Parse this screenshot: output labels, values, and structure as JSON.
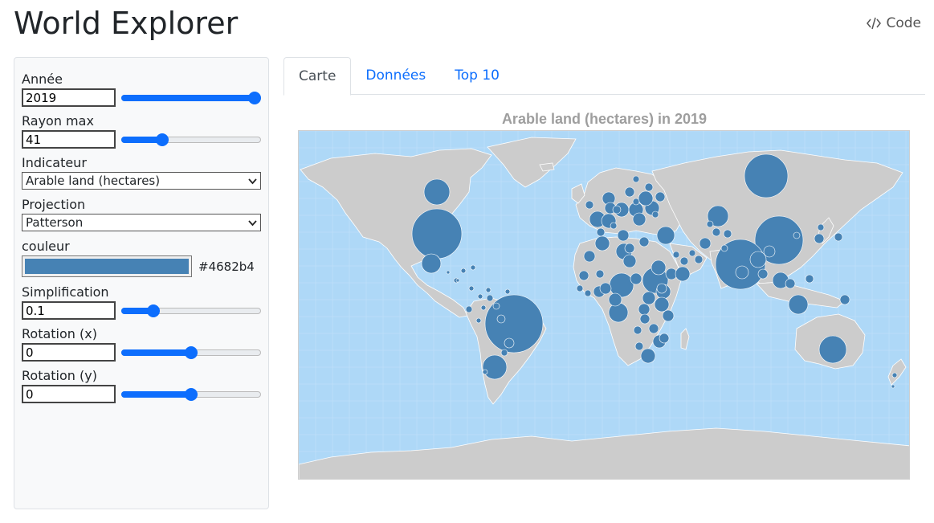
{
  "header": {
    "title": "World Explorer",
    "code_link": "Code"
  },
  "controls": {
    "year": {
      "label": "Année",
      "value": "2019",
      "min": 1961,
      "max": 2019,
      "current": 2019
    },
    "max_radius": {
      "label": "Rayon max",
      "value": "41",
      "min": 0,
      "max": 150,
      "current": 41
    },
    "indicator": {
      "label": "Indicateur",
      "selected": "Arable land (hectares)"
    },
    "projection": {
      "label": "Projection",
      "selected": "Patterson"
    },
    "color": {
      "label": "couleur",
      "hex": "#4682b4"
    },
    "simplification": {
      "label": "Simplification",
      "value": "0.1",
      "min": 0,
      "max": 0.5,
      "current": 0.1
    },
    "rotation_x": {
      "label": "Rotation (x)",
      "value": "0",
      "min": -180,
      "max": 180,
      "current": 0
    },
    "rotation_y": {
      "label": "Rotation (y)",
      "value": "0",
      "min": -90,
      "max": 90,
      "current": 0
    }
  },
  "tabs": [
    {
      "label": "Carte",
      "active": true
    },
    {
      "label": "Données",
      "active": false
    },
    {
      "label": "Top 10",
      "active": false
    }
  ],
  "map": {
    "title": "Arable land (hectares) in 2019",
    "ocean_color": "#aed8f7",
    "land_color": "#cccccc",
    "bubble_color": "#4682b4"
  },
  "colors": {
    "accent": "#0d6efd"
  }
}
